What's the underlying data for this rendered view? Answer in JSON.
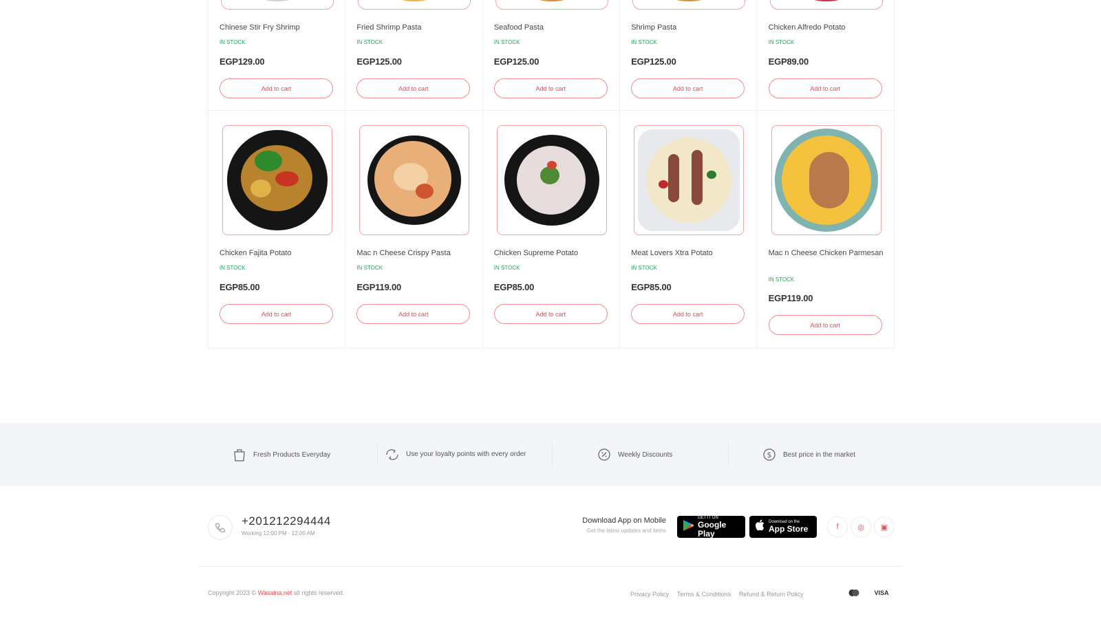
{
  "products_row1": [
    {
      "name": "Chinese Stir Fry Shrimp",
      "stock": "In stock",
      "price": "EGP129.00",
      "cart": "Add to cart",
      "food_color": "#c9c9c9"
    },
    {
      "name": "Fried Shrimp Pasta",
      "stock": "In stock",
      "price": "EGP125.00",
      "cart": "Add to cart",
      "food_color": "#e9b347"
    },
    {
      "name": "Seafood Pasta",
      "stock": "In stock",
      "price": "EGP125.00",
      "cart": "Add to cart",
      "food_color": "#d98b3a"
    },
    {
      "name": "Shrimp Pasta",
      "stock": "In stock",
      "price": "EGP125.00",
      "cart": "Add to cart",
      "food_color": "#d6923d"
    },
    {
      "name": "Chicken Alfredo Potato",
      "stock": "In stock",
      "price": "EGP89.00",
      "cart": "Add to cart",
      "food_color": "#c4374a"
    }
  ],
  "products_row2": [
    {
      "name": "Chicken Fajita Potato",
      "stock": "In stock",
      "price": "EGP85.00",
      "cart": "Add to cart"
    },
    {
      "name": "Mac n Cheese Crispy Pasta",
      "stock": "In stock",
      "price": "EGP119.00",
      "cart": "Add to cart"
    },
    {
      "name": "Chicken Supreme Potato",
      "stock": "In stock",
      "price": "EGP85.00",
      "cart": "Add to cart"
    },
    {
      "name": "Meat Lovers Xtra Potato",
      "stock": "In stock",
      "price": "EGP85.00",
      "cart": "Add to cart"
    },
    {
      "name": "Mac n Cheese Chicken Parmesan",
      "stock": "In stock",
      "price": "EGP119.00",
      "cart": "Add to cart"
    }
  ],
  "features": [
    {
      "label": "Fresh Products Everyday",
      "icon": "bag-icon"
    },
    {
      "label": "Use your loyalty points with every order",
      "icon": "points-icon"
    },
    {
      "label": "Weekly Discounts",
      "icon": "discount-icon"
    },
    {
      "label": "Best price in the market",
      "icon": "dollar-icon"
    }
  ],
  "contact": {
    "phone": "+201212294444",
    "hours": "Working 12:00 PM - 12:00 AM"
  },
  "download": {
    "title": "Download App on Mobile",
    "subtitle": "Get the latest updates and items",
    "google_small": "GET IT ON",
    "google_big": "Google Play",
    "apple_small": "Download on the",
    "apple_big": "App Store"
  },
  "social": [
    {
      "icon": "facebook-icon",
      "glyph": "f"
    },
    {
      "icon": "whatsapp-icon",
      "glyph": "◎"
    },
    {
      "icon": "instagram-icon",
      "glyph": "▣"
    }
  ],
  "footer": {
    "copyright_prefix": "Copyright 2023 ©",
    "brand": "Wasalna.net",
    "copyright_suffix": "all rights reserved.",
    "links": [
      "Privacy Policy",
      "Terms & Conditions",
      "Refund & Return Policy"
    ],
    "payment_visa": "VISA"
  },
  "colors": {
    "accent": "#e44b55",
    "in_stock": "#1ea65a",
    "band_bg": "#f3f5f8"
  }
}
